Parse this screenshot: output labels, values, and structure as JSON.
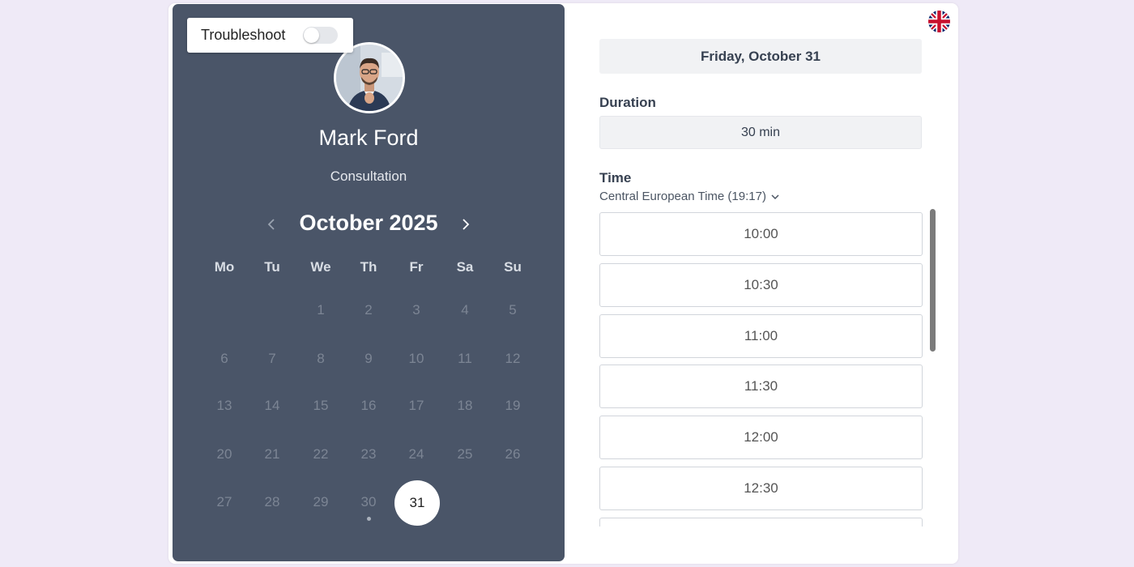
{
  "troubleshoot": {
    "label": "Troubleshoot",
    "enabled": false
  },
  "host": {
    "name": "Mark Ford",
    "event_type": "Consultation"
  },
  "calendar": {
    "month_label": "October 2025",
    "weekdays": [
      "Mo",
      "Tu",
      "We",
      "Th",
      "Fr",
      "Sa",
      "Su"
    ],
    "days": [
      "1",
      "2",
      "3",
      "4",
      "5",
      "6",
      "7",
      "8",
      "9",
      "10",
      "11",
      "12",
      "13",
      "14",
      "15",
      "16",
      "17",
      "18",
      "19",
      "20",
      "21",
      "22",
      "23",
      "24",
      "25",
      "26",
      "27",
      "28",
      "29",
      "30",
      "31"
    ],
    "selected_day": "31"
  },
  "booking": {
    "selected_date": "Friday, October 31",
    "duration_label": "Duration",
    "duration_value": "30 min",
    "time_label": "Time",
    "timezone": "Central European Time (19:17)"
  },
  "time_slots": [
    "10:00",
    "10:30",
    "11:00",
    "11:30",
    "12:00",
    "12:30",
    ""
  ],
  "icons": {
    "prev": "chevron-left-icon",
    "next": "chevron-right-icon",
    "timezone": "chevron-down-icon",
    "language": "uk-flag-icon"
  },
  "colors": {
    "left_panel": "#4a5568",
    "background": "#efeaf7",
    "selected_day_bg": "#ffffff"
  }
}
